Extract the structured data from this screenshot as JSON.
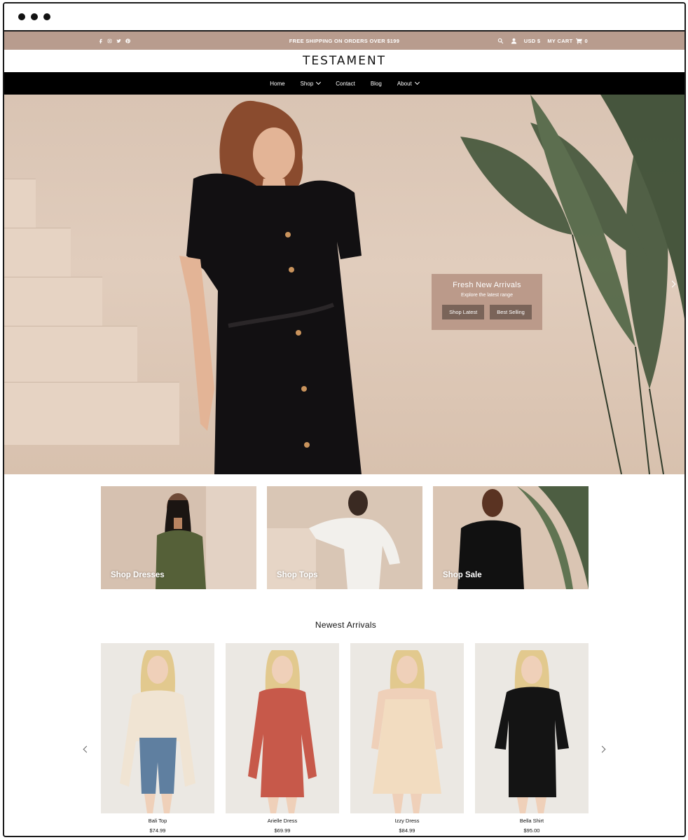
{
  "window": {
    "controls": [
      "dot",
      "dot",
      "dot"
    ]
  },
  "topbar": {
    "social_icons": [
      "facebook-icon",
      "instagram-icon",
      "twitter-icon",
      "pinterest-icon"
    ],
    "shipping_text": "FREE SHIPPING ON ORDERS OVER $199",
    "currency": "USD $",
    "cart_label": "MY CART",
    "cart_count": "0",
    "bg_color": "#b89c8e"
  },
  "brand": {
    "logo": "TESTAMENT"
  },
  "nav": {
    "items": [
      {
        "label": "Home"
      },
      {
        "label": "Shop"
      },
      {
        "label": "Contact"
      },
      {
        "label": "Blog"
      },
      {
        "label": "About"
      }
    ]
  },
  "hero": {
    "title": "Fresh New Arrivals",
    "subtitle": "Explore the latest range",
    "buttons": [
      "Shop Latest",
      "Best Selling"
    ]
  },
  "collections": [
    {
      "label": "Shop Dresses"
    },
    {
      "label": "Shop Tops"
    },
    {
      "label": "Shop Sale"
    }
  ],
  "newest": {
    "title": "Newest Arrivals",
    "products": [
      {
        "name": "Bali Top",
        "price": "$74.99"
      },
      {
        "name": "Arielle Dress",
        "price": "$69.99"
      },
      {
        "name": "Izzy Dress",
        "price": "$84.99"
      },
      {
        "name": "Bella Shirt",
        "price": "$95.00"
      }
    ]
  }
}
